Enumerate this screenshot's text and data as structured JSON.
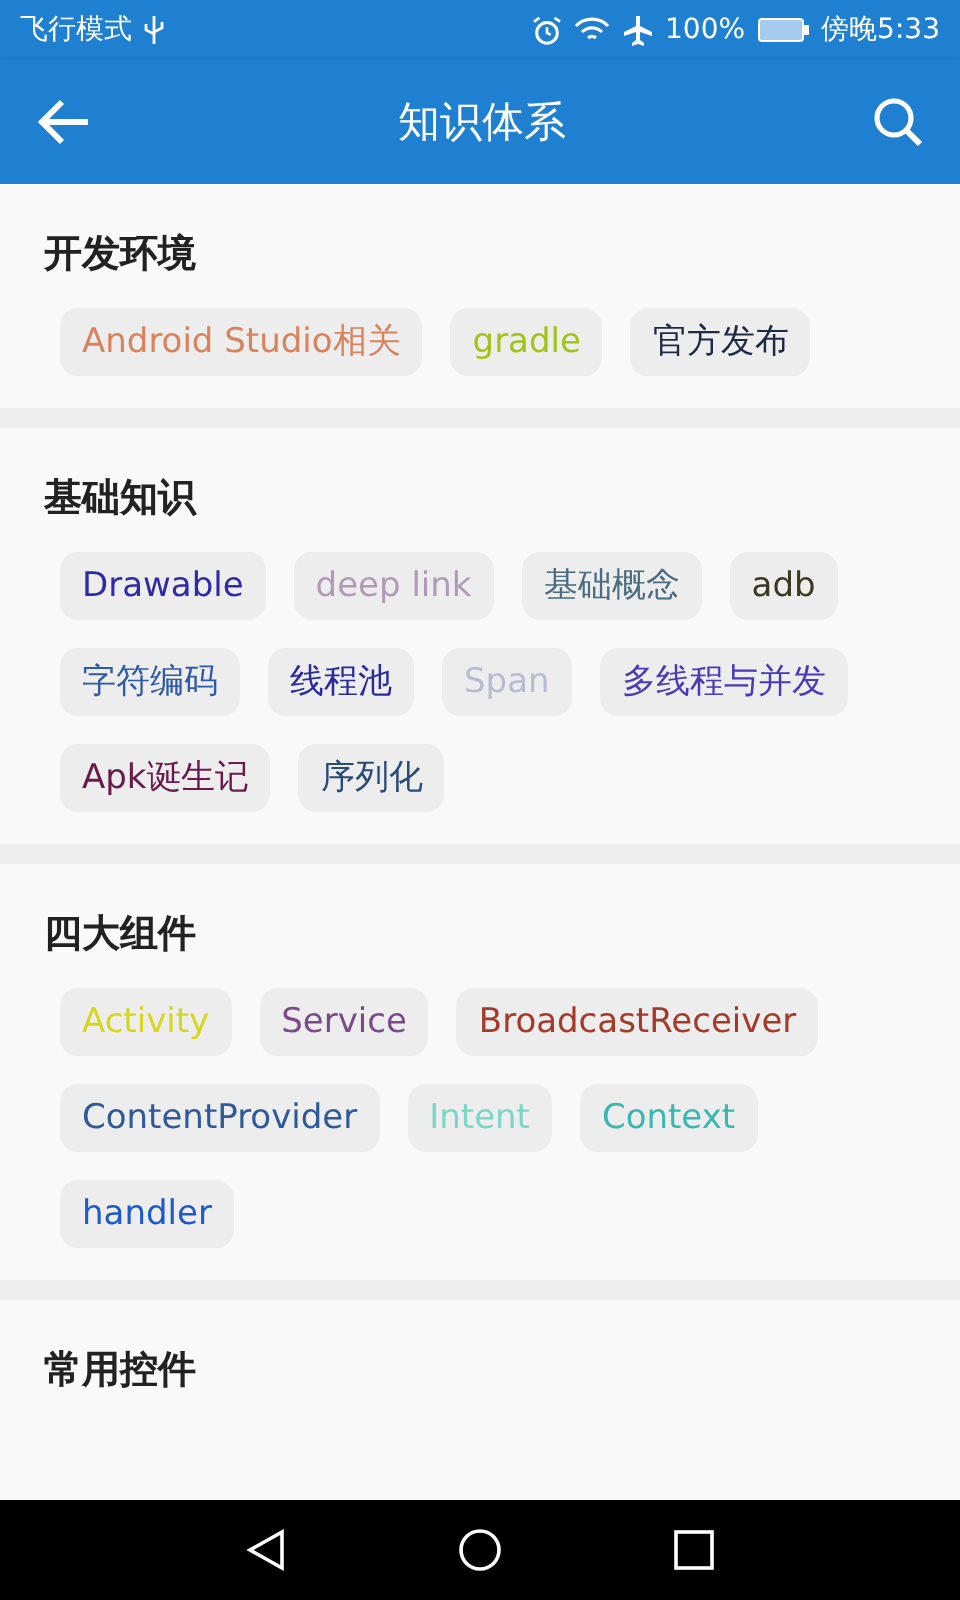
{
  "status_bar": {
    "carrier": "飞行模式",
    "battery": "100%",
    "time": "傍晚5:33"
  },
  "toolbar": {
    "title": "知识体系"
  },
  "sections": [
    {
      "title": "开发环境",
      "tags": [
        {
          "label": "Android Studio相关",
          "color": "#d9825b"
        },
        {
          "label": "gradle",
          "color": "#a4c21a"
        },
        {
          "label": "官方发布",
          "color": "#1e2a44"
        }
      ]
    },
    {
      "title": "基础知识",
      "tags": [
        {
          "label": "Drawable",
          "color": "#2e2aa8"
        },
        {
          "label": "deep link",
          "color": "#b09ab8"
        },
        {
          "label": "基础概念",
          "color": "#4a6c80"
        },
        {
          "label": "adb",
          "color": "#3a3a22"
        },
        {
          "label": "字符编码",
          "color": "#2e5aa8"
        },
        {
          "label": "线程池",
          "color": "#2a2a9a"
        },
        {
          "label": "Span",
          "color": "#b8bcd0"
        },
        {
          "label": "多线程与并发",
          "color": "#4a3ab8"
        },
        {
          "label": "Apk诞生记",
          "color": "#6a1a4a"
        },
        {
          "label": "序列化",
          "color": "#2a4a7a"
        }
      ]
    },
    {
      "title": "四大组件",
      "tags": [
        {
          "label": "Activity",
          "color": "#d6d61e"
        },
        {
          "label": "Service",
          "color": "#7a4a8a"
        },
        {
          "label": "BroadcastReceiver",
          "color": "#a43a2a"
        },
        {
          "label": "ContentProvider",
          "color": "#2e5a9a"
        },
        {
          "label": "Intent",
          "color": "#7ad6c6"
        },
        {
          "label": "Context",
          "color": "#3ab8b0"
        },
        {
          "label": "handler",
          "color": "#1e5ac8"
        }
      ]
    },
    {
      "title": "常用控件"
    }
  ]
}
